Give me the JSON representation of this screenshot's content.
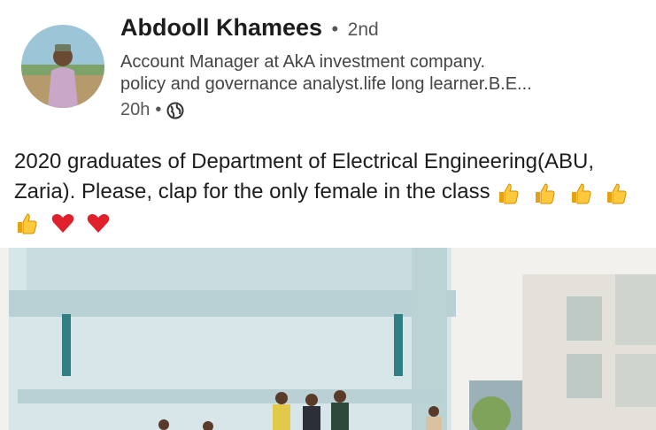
{
  "author": {
    "name": "Abdooll Khamees",
    "separator": "•",
    "degree": "2nd",
    "headline_line1": "Account Manager at AkA investment company.",
    "headline_line2": "policy and governance analyst.life long learner.B.E...",
    "time": "20h",
    "time_separator": "•",
    "visibility_icon": "globe-icon"
  },
  "post": {
    "text": "2020 graduates of Department of Electrical Engineering(ABU, Zaria). Please, clap for the only female in the class",
    "emojis": [
      "thumbs-up",
      "thumbs-up",
      "thumbs-up",
      "thumbs-up",
      "thumbs-up",
      "red-heart",
      "red-heart"
    ]
  },
  "colors": {
    "text_primary": "#1d1d1d",
    "text_secondary": "#555555",
    "building": "#c9dcdf",
    "sky": "#f3f1ee"
  }
}
